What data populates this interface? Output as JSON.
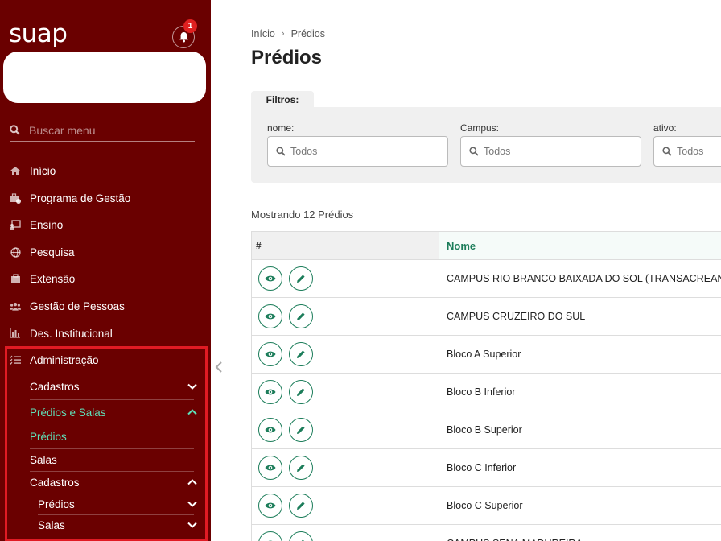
{
  "app": {
    "logo": "suap",
    "notification_count": "1"
  },
  "sidebar": {
    "search_placeholder": "Buscar menu",
    "items": [
      {
        "label": "Início",
        "icon": "home-icon"
      },
      {
        "label": "Programa de Gestão",
        "icon": "briefcase-gear-icon"
      },
      {
        "label": "Ensino",
        "icon": "teacher-board-icon"
      },
      {
        "label": "Pesquisa",
        "icon": "globe-icon"
      },
      {
        "label": "Extensão",
        "icon": "building-icon"
      },
      {
        "label": "Gestão de Pessoas",
        "icon": "users-icon"
      },
      {
        "label": "Des. Institucional",
        "icon": "bar-chart-icon"
      },
      {
        "label": "Administração",
        "icon": "list-check-icon"
      }
    ],
    "admin_sub": {
      "cadastros": "Cadastros",
      "predios_e_salas": "Prédios e Salas",
      "predios": "Prédios",
      "salas": "Salas",
      "cadastros2": "Cadastros",
      "predios_nested": "Prédios",
      "salas_nested": "Salas"
    }
  },
  "breadcrumb": {
    "home": "Início",
    "current": "Prédios"
  },
  "page_title": "Prédios",
  "filters": {
    "tab_label": "Filtros:",
    "nome_label": "nome:",
    "nome_value": "Todos",
    "campus_label": "Campus:",
    "campus_value": "Todos",
    "ativo_label": "ativo:",
    "ativo_value": "Todos"
  },
  "count_text": "Mostrando 12 Prédios",
  "table": {
    "col_actions": "#",
    "col_nome": "Nome",
    "rows": [
      "CAMPUS RIO BRANCO BAIXADA DO SOL (TRANSACREANA)",
      "CAMPUS CRUZEIRO DO SUL",
      "Bloco A Superior",
      "Bloco B Inferior",
      "Bloco B Superior",
      "Bloco C Inferior",
      "Bloco C Superior",
      "CAMPUS SENA MADUREIRA"
    ]
  },
  "colors": {
    "sidebar_bg": "#6a0000",
    "accent_green": "#1c7d5a",
    "active_link": "#5ee0b8",
    "highlight_border": "#e01b24"
  }
}
